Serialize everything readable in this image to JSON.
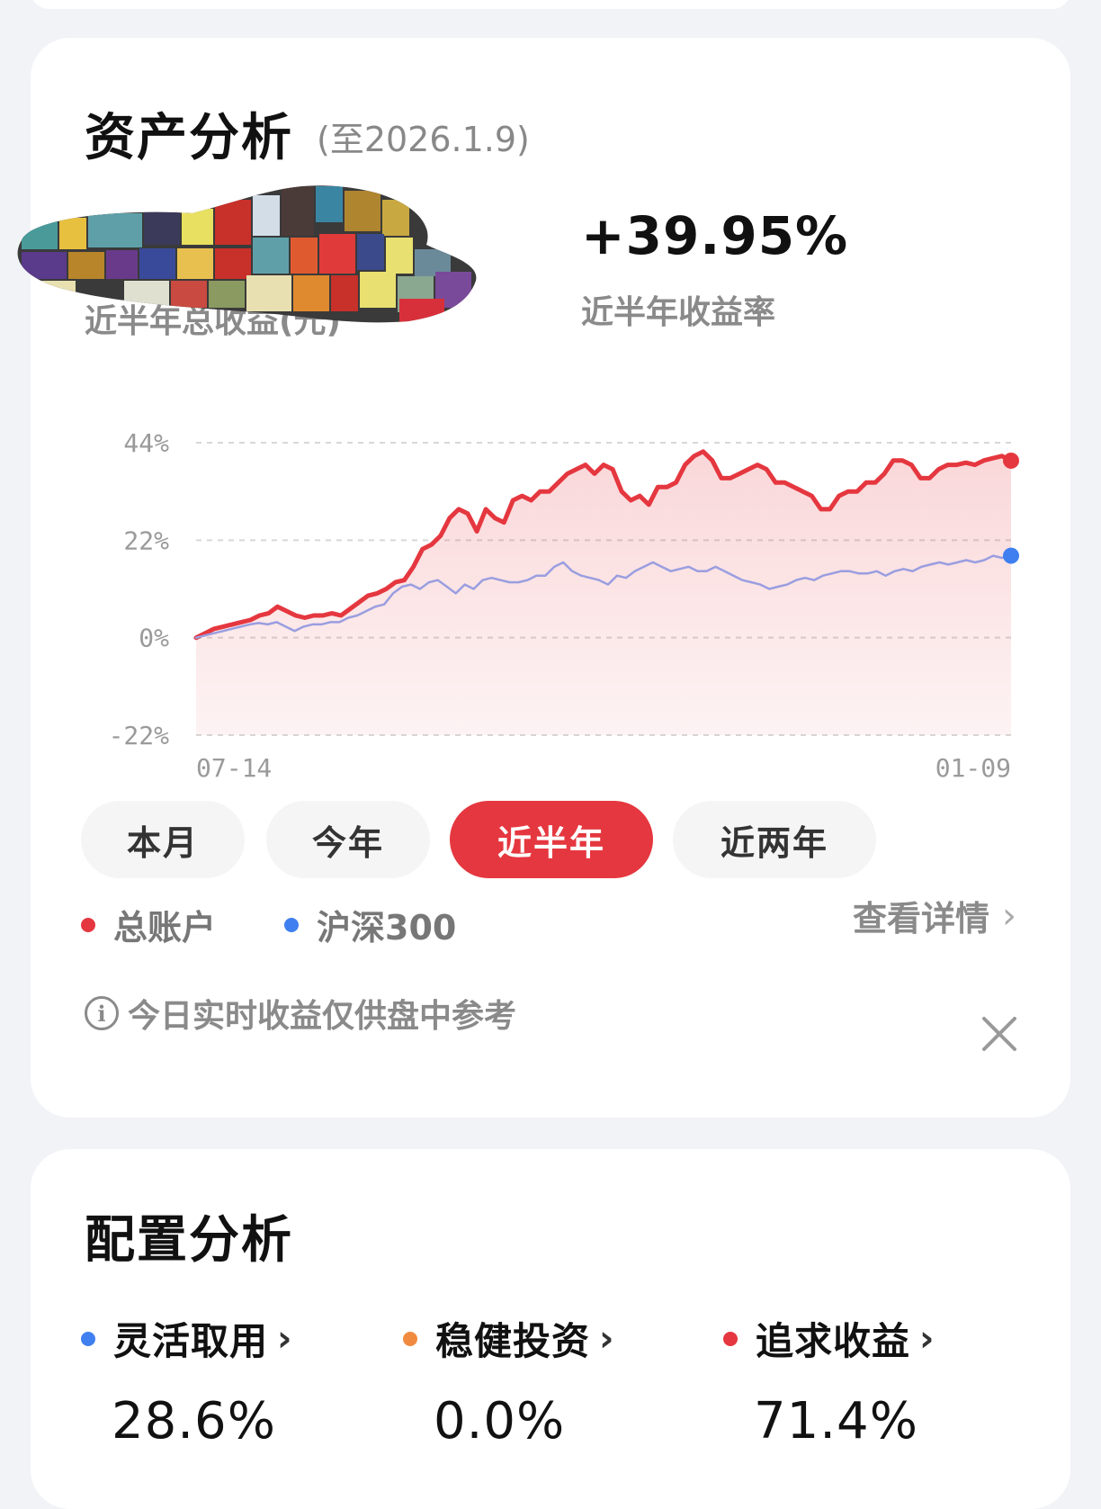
{
  "asset_analysis": {
    "title": "资产分析",
    "date_note": "(至2026.1.9)",
    "total_profit_label": "近半年总收益(元)",
    "return_rate_value": "+39.95%",
    "return_rate_label": "近半年收益率"
  },
  "chart_data": {
    "type": "line",
    "y_ticks": [
      "44%",
      "22%",
      "0%",
      "-22%"
    ],
    "ylim": [
      -22,
      44
    ],
    "x_tick_labels": [
      "07-14",
      "01-09"
    ],
    "grid": true,
    "series": [
      {
        "name": "总账户",
        "color": "#e5373f",
        "fill": true,
        "values": [
          0,
          1,
          2,
          2.5,
          3,
          3.5,
          4,
          5,
          5.5,
          7,
          6,
          5,
          4.5,
          5,
          5,
          5.5,
          5,
          6.5,
          8,
          9.5,
          10,
          11,
          12.5,
          13,
          16,
          20,
          21,
          23,
          27,
          29,
          28,
          24,
          29,
          27,
          26,
          31,
          32,
          31,
          33,
          33,
          35,
          37,
          38,
          39,
          37,
          39,
          38,
          33,
          31,
          32,
          30,
          34,
          34,
          35,
          39,
          41,
          42,
          40,
          36,
          36,
          37,
          38,
          39,
          38,
          35,
          35,
          34,
          33,
          32,
          29,
          29,
          32,
          33,
          33,
          35,
          35,
          37,
          40,
          40,
          39,
          36,
          36,
          38,
          39,
          39,
          39.5,
          39,
          40,
          40.5,
          41,
          39.95
        ]
      },
      {
        "name": "沪深300",
        "color": "#9a9ee0",
        "fill": false,
        "endpoint_color": "#3f7ff0",
        "values": [
          0,
          0.5,
          1,
          1.5,
          2,
          2.5,
          3,
          3.3,
          3,
          3.5,
          2.5,
          1.5,
          2.5,
          3,
          3,
          3.5,
          3.5,
          4.5,
          5,
          6,
          7,
          7.5,
          10,
          11.5,
          12,
          11,
          12.5,
          13,
          11.5,
          10,
          12,
          11,
          13,
          13.5,
          13,
          12.5,
          12.5,
          13,
          14,
          14,
          16,
          17,
          15,
          14,
          13.5,
          13,
          12,
          14,
          13.5,
          15,
          16,
          17,
          16,
          15,
          15.5,
          16,
          15,
          15,
          16,
          15,
          14,
          13,
          12.5,
          12,
          11,
          11.5,
          12,
          13,
          13.5,
          13,
          14,
          14.5,
          15,
          15,
          14.5,
          14.5,
          15,
          14,
          15,
          15.5,
          15,
          16,
          16.5,
          17,
          16.5,
          17,
          17.5,
          17,
          17.5,
          18.5,
          18,
          18.5
        ]
      }
    ]
  },
  "period_tabs": [
    {
      "label": "本月"
    },
    {
      "label": "今年"
    },
    {
      "label": "近半年"
    },
    {
      "label": "近两年"
    }
  ],
  "legend": {
    "account": "总账户",
    "index": "沪深300",
    "detail_link": "查看详情",
    "chevron": "›"
  },
  "notice": {
    "icon": "i",
    "text": "今日实时收益仅供盘中参考"
  },
  "config_analysis": {
    "title": "配置分析",
    "items": [
      {
        "label": "灵活取用",
        "value": "28.6%",
        "color": "#3f7ff0"
      },
      {
        "label": "稳健投资",
        "value": "0.0%",
        "color": "#f08a3f"
      },
      {
        "label": "追求收益",
        "value": "71.4%",
        "color": "#e5373f"
      }
    ]
  },
  "colors": {
    "accent": "#e5373f",
    "index_blue": "#3f7ff0",
    "muted_text": "#8a8a8a",
    "background": "#f2f3f7"
  }
}
